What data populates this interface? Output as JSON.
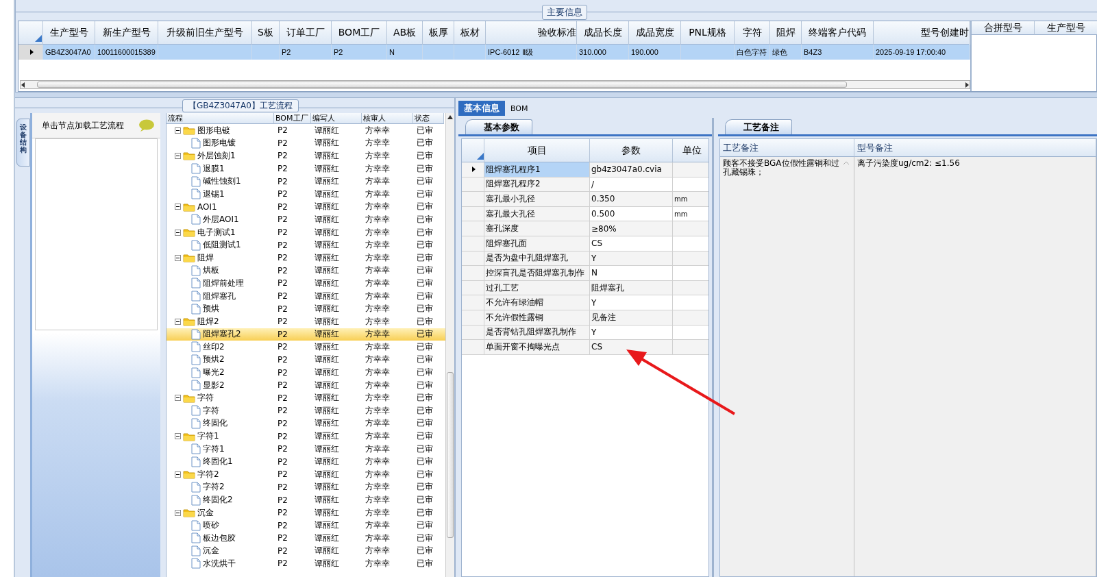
{
  "main_info": {
    "title": "主要信息",
    "columns": [
      "生产型号",
      "新生产型号",
      "升级前旧生产型号",
      "S板",
      "订单工厂",
      "BOM工厂",
      "AB板",
      "板厚",
      "板材",
      "验收标准",
      "成品长度",
      "成品宽度",
      "PNL规格",
      "字符",
      "阻焊",
      "终端客户代码",
      "型号创建时"
    ],
    "rows": [
      {
        "selected": true,
        "cells": [
          "GB4Z3047A0",
          "10011600015389",
          null,
          null,
          "P2",
          "P2",
          "N",
          null,
          null,
          "IPC-6012 Ⅱ级",
          "310.000",
          "190.000",
          null,
          "白色字符",
          "绿色",
          "B4Z3",
          "2025-09-19 17:00:40"
        ]
      }
    ],
    "side_columns": [
      "合拼型号",
      "生产型号"
    ]
  },
  "flow": {
    "title": "【GB4Z3047A0】工艺流程",
    "side_tab": "设备结构",
    "hint": "单击节点加载工艺流程",
    "columns": [
      "流程",
      "BOM工厂",
      "编写人",
      "核审人",
      "状态"
    ],
    "tree": [
      {
        "name": "图形电镀",
        "selected": false,
        "expanded": true,
        "cells": [
          "P2",
          "谭丽红",
          "方幸幸",
          "已审"
        ],
        "children": [
          {
            "name": "图形电镀",
            "selected": false,
            "cells": [
              "P2",
              "谭丽红",
              "方幸幸",
              "已审"
            ]
          }
        ]
      },
      {
        "name": "外层蚀刻1",
        "selected": false,
        "expanded": true,
        "cells": [
          "P2",
          "谭丽红",
          "方幸幸",
          "已审"
        ],
        "children": [
          {
            "name": "退膜1",
            "selected": false,
            "cells": [
              "P2",
              "谭丽红",
              "方幸幸",
              "已审"
            ]
          },
          {
            "name": "碱性蚀刻1",
            "selected": false,
            "cells": [
              "P2",
              "谭丽红",
              "方幸幸",
              "已审"
            ]
          },
          {
            "name": "退锡1",
            "selected": false,
            "cells": [
              "P2",
              "谭丽红",
              "方幸幸",
              "已审"
            ]
          }
        ]
      },
      {
        "name": "AOI1",
        "selected": false,
        "expanded": true,
        "cells": [
          "P2",
          "谭丽红",
          "方幸幸",
          "已审"
        ],
        "children": [
          {
            "name": "外层AOI1",
            "selected": false,
            "cells": [
              "P2",
              "谭丽红",
              "方幸幸",
              "已审"
            ]
          }
        ]
      },
      {
        "name": "电子测试1",
        "selected": false,
        "expanded": true,
        "cells": [
          "P2",
          "谭丽红",
          "方幸幸",
          "已审"
        ],
        "children": [
          {
            "name": "低阻测试1",
            "selected": false,
            "cells": [
              "P2",
              "谭丽红",
              "方幸幸",
              "已审"
            ]
          }
        ]
      },
      {
        "name": "阻焊",
        "selected": false,
        "expanded": true,
        "cells": [
          "P2",
          "谭丽红",
          "方幸幸",
          "已审"
        ],
        "children": [
          {
            "name": "烘板",
            "selected": false,
            "cells": [
              "P2",
              "谭丽红",
              "方幸幸",
              "已审"
            ]
          },
          {
            "name": "阻焊前处理",
            "selected": false,
            "cells": [
              "P2",
              "谭丽红",
              "方幸幸",
              "已审"
            ]
          },
          {
            "name": "阻焊塞孔",
            "selected": false,
            "cells": [
              "P2",
              "谭丽红",
              "方幸幸",
              "已审"
            ]
          },
          {
            "name": "预烘",
            "selected": false,
            "cells": [
              "P2",
              "谭丽红",
              "方幸幸",
              "已审"
            ]
          }
        ]
      },
      {
        "name": "阻焊2",
        "selected": false,
        "expanded": true,
        "cells": [
          "P2",
          "谭丽红",
          "方幸幸",
          "已审"
        ],
        "children": [
          {
            "name": "阻焊塞孔2",
            "selected": true,
            "cells": [
              "P2",
              "谭丽红",
              "方幸幸",
              "已审"
            ]
          },
          {
            "name": "丝印2",
            "selected": false,
            "cells": [
              "P2",
              "谭丽红",
              "方幸幸",
              "已审"
            ]
          },
          {
            "name": "预烘2",
            "selected": false,
            "cells": [
              "P2",
              "谭丽红",
              "方幸幸",
              "已审"
            ]
          },
          {
            "name": "曝光2",
            "selected": false,
            "cells": [
              "P2",
              "谭丽红",
              "方幸幸",
              "已审"
            ]
          },
          {
            "name": "显影2",
            "selected": false,
            "cells": [
              "P2",
              "谭丽红",
              "方幸幸",
              "已审"
            ]
          }
        ]
      },
      {
        "name": "字符",
        "selected": false,
        "expanded": true,
        "cells": [
          "P2",
          "谭丽红",
          "方幸幸",
          "已审"
        ],
        "children": [
          {
            "name": "字符",
            "selected": false,
            "cells": [
              "P2",
              "谭丽红",
              "方幸幸",
              "已审"
            ]
          },
          {
            "name": "终固化",
            "selected": false,
            "cells": [
              "P2",
              "谭丽红",
              "方幸幸",
              "已审"
            ]
          }
        ]
      },
      {
        "name": "字符1",
        "selected": false,
        "expanded": true,
        "cells": [
          "P2",
          "谭丽红",
          "方幸幸",
          "已审"
        ],
        "children": [
          {
            "name": "字符1",
            "selected": false,
            "cells": [
              "P2",
              "谭丽红",
              "方幸幸",
              "已审"
            ]
          },
          {
            "name": "终固化1",
            "selected": false,
            "cells": [
              "P2",
              "谭丽红",
              "方幸幸",
              "已审"
            ]
          }
        ]
      },
      {
        "name": "字符2",
        "selected": false,
        "expanded": true,
        "cells": [
          "P2",
          "谭丽红",
          "方幸幸",
          "已审"
        ],
        "children": [
          {
            "name": "字符2",
            "selected": false,
            "cells": [
              "P2",
              "谭丽红",
              "方幸幸",
              "已审"
            ]
          },
          {
            "name": "终固化2",
            "selected": false,
            "cells": [
              "P2",
              "谭丽红",
              "方幸幸",
              "已审"
            ]
          }
        ]
      },
      {
        "name": "沉金",
        "selected": false,
        "expanded": true,
        "cells": [
          "P2",
          "谭丽红",
          "方幸幸",
          "已审"
        ],
        "children": [
          {
            "name": "喷砂",
            "selected": false,
            "cells": [
              "P2",
              "谭丽红",
              "方幸幸",
              "已审"
            ]
          },
          {
            "name": "板边包胶",
            "selected": false,
            "cells": [
              "P2",
              "谭丽红",
              "方幸幸",
              "已审"
            ]
          },
          {
            "name": "沉金",
            "selected": false,
            "cells": [
              "P2",
              "谭丽红",
              "方幸幸",
              "已审"
            ]
          },
          {
            "name": "水洗烘干",
            "selected": false,
            "cells": [
              "P2",
              "谭丽红",
              "方幸幸",
              "已审"
            ]
          }
        ]
      }
    ]
  },
  "info_tabs": [
    {
      "label": "基本信息",
      "selected": true
    },
    {
      "label": "BOM",
      "selected": false
    }
  ],
  "params": {
    "tab": "基本参数",
    "columns": [
      "项目",
      "参数",
      "单位"
    ],
    "rows": [
      {
        "item": "阻焊塞孔程序1",
        "value": "gb4z3047a0.cvia",
        "selected": true
      },
      {
        "item": "阻焊塞孔程序2",
        "value": "/",
        "selected": false
      },
      {
        "item": "塞孔最小孔径",
        "value": "0.350",
        "unit": "mm",
        "selected": false
      },
      {
        "item": "塞孔最大孔径",
        "value": "0.500",
        "unit": "mm",
        "selected": false
      },
      {
        "item": "塞孔深度",
        "value": "≥80%",
        "selected": false
      },
      {
        "item": "阻焊塞孔面",
        "value": "CS",
        "selected": false
      },
      {
        "item": "是否为盘中孔阻焊塞孔",
        "value": "Y",
        "selected": false
      },
      {
        "item": "控深盲孔是否阻焊塞孔制作",
        "value": "N",
        "selected": false
      },
      {
        "item": "过孔工艺",
        "value": "阻焊塞孔",
        "selected": false
      },
      {
        "item": "不允许有绿油帽",
        "value": "Y",
        "selected": false
      },
      {
        "item": "不允许假性露铜",
        "value": "见备注",
        "selected": false
      },
      {
        "item": "是否背钻孔阻焊塞孔制作",
        "value": "Y",
        "selected": false
      },
      {
        "item": "单面开窗不掏曝光点",
        "value": "CS",
        "selected": false
      }
    ]
  },
  "notes": {
    "tab": "工艺备注",
    "columns": [
      "工艺备注",
      "型号备注"
    ],
    "cells": [
      "顾客不接受BGA位假性露铜和过孔藏锡珠；",
      "离子污染度ug/cm2: ≤1.56"
    ]
  }
}
